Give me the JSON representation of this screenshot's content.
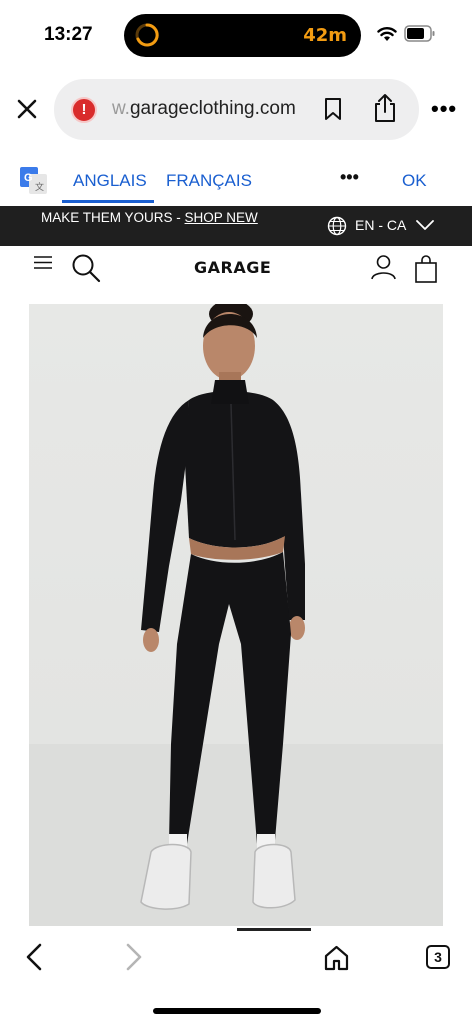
{
  "status_bar": {
    "time": "13:27",
    "timer": "42m",
    "accent_color": "#f39c12"
  },
  "browser": {
    "url_prefix": "w.",
    "url_main": "garageclothing.com",
    "alert_glyph": "!",
    "more_glyph": "•••",
    "icons": [
      "close-icon",
      "site-alert-icon",
      "bookmark-icon",
      "share-icon",
      "more-icon"
    ]
  },
  "translate": {
    "source_lang": "ANGLAIS",
    "target_lang": "FRANÇAIS",
    "more_glyph": "•••",
    "ok_label": "OK",
    "accent_color": "#1a5fd0"
  },
  "promo": {
    "text": "MAKE THEM YOURS - ",
    "link_text": "SHOP NEW",
    "locale": "EN - CA"
  },
  "site": {
    "logo": "GARAGE",
    "icons": [
      "menu-icon",
      "search-icon",
      "account-icon",
      "bag-icon"
    ]
  },
  "toolbar": {
    "tab_count": "3",
    "icons": [
      "back-icon",
      "forward-icon",
      "home-icon",
      "tabs-icon"
    ]
  }
}
